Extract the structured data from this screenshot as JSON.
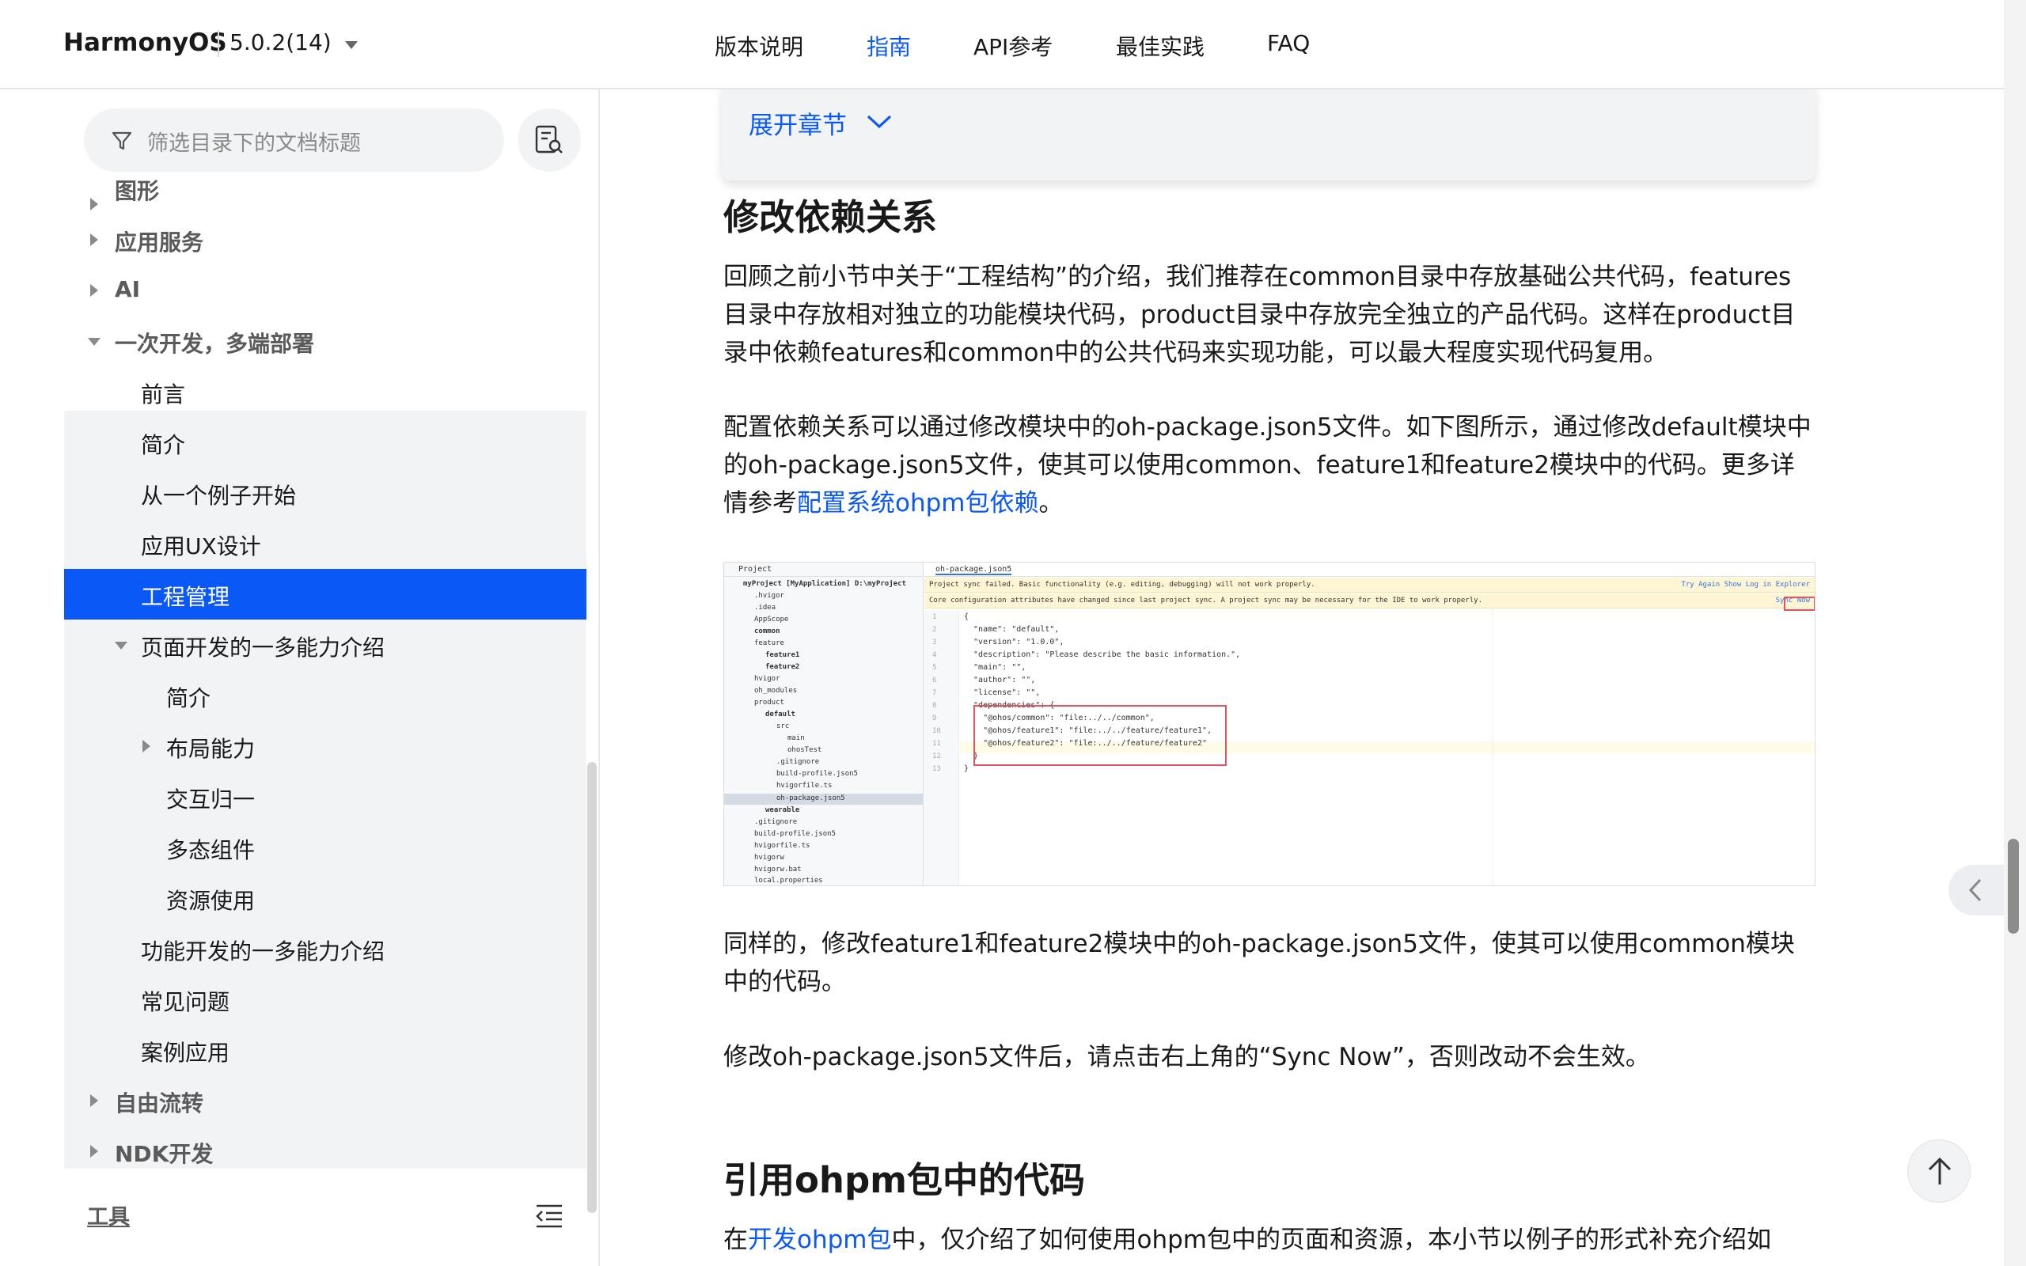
{
  "header": {
    "brand": "HarmonyOS",
    "version": "5.0.2(14)",
    "nav": [
      "版本说明",
      "指南",
      "API参考",
      "最佳实践",
      "FAQ"
    ],
    "active_nav": "指南"
  },
  "sidebar": {
    "filter_placeholder": "筛选目录下的文档标题",
    "items": [
      {
        "label": "图形",
        "level": 0,
        "state": "collapsed"
      },
      {
        "label": "应用服务",
        "level": 0,
        "state": "collapsed"
      },
      {
        "label": "AI",
        "level": 0,
        "state": "collapsed"
      },
      {
        "label": "一次开发，多端部署",
        "level": 0,
        "state": "expanded"
      },
      {
        "label": "前言",
        "level": 1
      },
      {
        "label": "简介",
        "level": 1
      },
      {
        "label": "从一个例子开始",
        "level": 1
      },
      {
        "label": "应用UX设计",
        "level": 1
      },
      {
        "label": "工程管理",
        "level": 1,
        "selected": true
      },
      {
        "label": "页面开发的一多能力介绍",
        "level": 1,
        "state": "expanded"
      },
      {
        "label": "简介",
        "level": 2
      },
      {
        "label": "布局能力",
        "level": 2,
        "state": "collapsed"
      },
      {
        "label": "交互归一",
        "level": 2
      },
      {
        "label": "多态组件",
        "level": 2
      },
      {
        "label": "资源使用",
        "level": 2
      },
      {
        "label": "功能开发的一多能力介绍",
        "level": 1
      },
      {
        "label": "常见问题",
        "level": 1
      },
      {
        "label": "案例应用",
        "level": 1
      },
      {
        "label": "自由流转",
        "level": 0,
        "state": "collapsed"
      },
      {
        "label": "NDK开发",
        "level": 0,
        "state": "collapsed"
      }
    ],
    "tools_label": "工具"
  },
  "content": {
    "expand_label": "展开章节",
    "section1_title": "修改依赖关系",
    "para1": "回顾之前小节中关于“工程结构”的介绍，我们推荐在common目录中存放基础公共代码，features目录中存放相对独立的功能模块代码，product目录中存放完全独立的产品代码。这样在product目录中依赖features和common中的公共代码来实现功能，可以最大程度实现代码复用。",
    "para2_before": "配置依赖关系可以通过修改模块中的oh-package.json5文件。如下图所示，通过修改default模块中的oh-package.json5文件，使其可以使用common、feature1和feature2模块中的代码。更多详情参考",
    "para2_link": "配置系统ohpm包依赖",
    "para2_after": "。",
    "para3": "同样的，修改feature1和feature2模块中的oh-package.json5文件，使其可以使用common模块中的代码。",
    "para4": "修改oh-package.json5文件后，请点击右上角的“Sync Now”，否则改动不会生效。",
    "section2_title": "引用ohpm包中的代码",
    "para5_before": "在",
    "para5_link": "开发ohpm包",
    "para5_after": "中，仅介绍了如何使用ohpm包中的页面和资源，本小节以例子的形式补充介绍如"
  },
  "ide": {
    "project_label": "Project",
    "tab": "oh-package.json5",
    "banner1": "Project sync failed. Basic functionality (e.g. editing, debugging) will not work properly.",
    "banner1_links": "Try Again    Show Log in Explorer",
    "banner2": "Core configuration attributes have changed since last project sync. A project sync may be necessary for the IDE to work properly.",
    "banner2_link": "Sync Now",
    "tree": [
      "myProject [MyApplication]  D:\\myProject",
      ".hvigor",
      ".idea",
      "AppScope",
      "common",
      "feature",
      "feature1",
      "feature2",
      "hvigor",
      "oh_modules",
      "product",
      "default",
      "src",
      "main",
      "ohosTest",
      ".gitignore",
      "build-profile.json5",
      "hvigorfile.ts",
      "oh-package.json5",
      "wearable",
      ".gitignore",
      "build-profile.json5",
      "hvigorfile.ts",
      "hvigorw",
      "hvigorw.bat",
      "local.properties"
    ],
    "code": [
      "{",
      "  \"name\": \"default\",",
      "  \"version\": \"1.0.0\",",
      "  \"description\": \"Please describe the basic information.\",",
      "  \"main\": \"\",",
      "  \"author\": \"\",",
      "  \"license\": \"\",",
      "  \"dependencies\": {",
      "    \"@ohos/common\": \"file:../../common\",",
      "    \"@ohos/feature1\": \"file:../../feature/feature1\",",
      "    \"@ohos/feature2\": \"file:../../feature/feature2\"",
      "  }",
      "}"
    ]
  }
}
